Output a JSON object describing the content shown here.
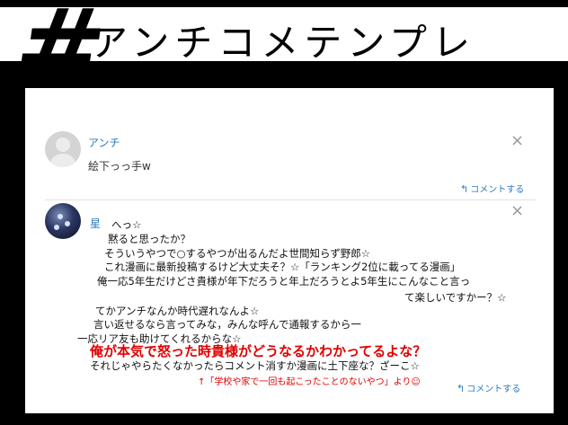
{
  "header": {
    "hash": "#",
    "title": "アンチコメテンプレ"
  },
  "comments": [
    {
      "username": "アンチ",
      "text": "絵下っっ手w",
      "reply_label": "コメントする",
      "close": "×"
    },
    {
      "username": "星",
      "reply_label": "コメントする",
      "close": "×",
      "lines": [
        "へっ☆",
        "黙ると思ったか？",
        "そういうやつで○するやつが出るんだよ世間知らず野郎☆",
        "これ漫画に最新投稿するけど大丈夫そ？☆「ランキング2位に載ってる漫画」",
        "俺一応5年生だけどさ貴様が年下だろうと年上だろうとよ5年生にこんなこと言っ",
        "て楽しいですかー？☆",
        "てかアンチなんか時代遅れなんよ☆",
        "言い返せるなら言ってみな，みんな呼んで通報するから一",
        "一応リア友も助けてくれるからな☆",
        "俺が本気で怒った時貴様がどうなるかわかってるよな？",
        "それじゃやらたくなかったらコメント消すか漫画に土下座な？ざーこ☆",
        "↑「学校や家で一回も起こったことのないやつ」より☺"
      ]
    }
  ],
  "icons": {
    "reply": "reply-arrow-icon",
    "close": "close-icon"
  },
  "colors": {
    "link": "#2b7bbf",
    "emphasis": "#e00000",
    "banner": "#000000"
  }
}
